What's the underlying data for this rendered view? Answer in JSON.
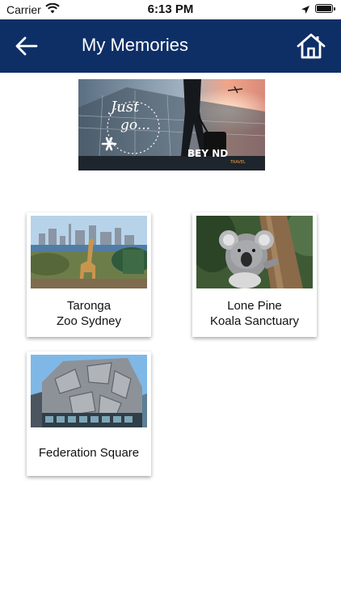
{
  "status_bar": {
    "carrier": "Carrier",
    "time": "6:13 PM"
  },
  "header": {
    "title": "My Memories",
    "back_icon": "arrow-left-icon",
    "home_icon": "home-icon"
  },
  "banner": {
    "script_text_1": "Just",
    "script_text_2": "go...",
    "brand": "BEY ND",
    "brand_sub": "TRAVEL"
  },
  "memories": [
    {
      "line1": "Taronga",
      "line2": "Zoo Sydney"
    },
    {
      "line1": "Lone Pine",
      "line2": "Koala Sanctuary"
    },
    {
      "line1": "Federation Square",
      "line2": ""
    }
  ],
  "colors": {
    "header_bg": "#0e2f66",
    "header_text": "#ffffff"
  }
}
